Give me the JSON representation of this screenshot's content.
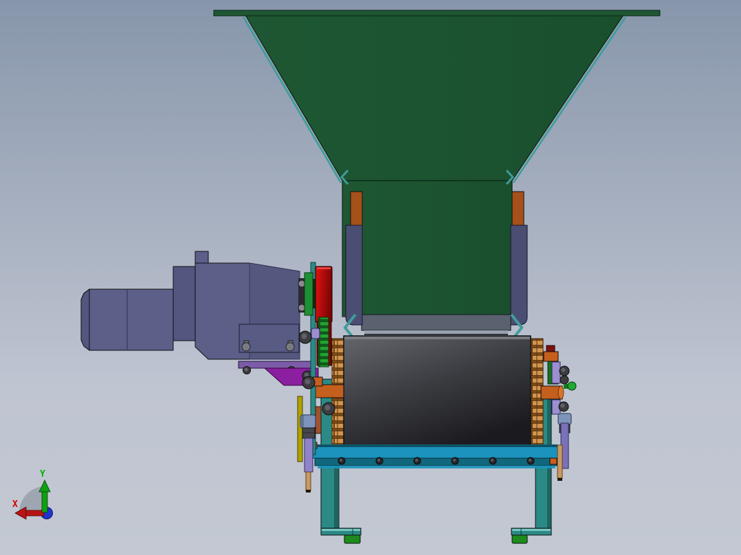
{
  "viewport": {
    "kind": "shaded 3d model side view",
    "triad": {
      "x_label": "X",
      "y_label": "Y",
      "x_color": "#d40000",
      "y_color": "#00b400",
      "z_color": "#2234cf",
      "fan_color": "#98a0ac"
    }
  },
  "palette": {
    "bg_top": "#8796ab",
    "bg_bottom": "#c3c8d2",
    "hopper_green": "#1e5733",
    "hopper_green_dark": "#1a4f2e",
    "edge_teal": "#3f9d9b",
    "chute_band_gray": "#59626e",
    "chute_band_light": "#97a0ac",
    "guard_slate": "#4b4e73",
    "bracket_rust": "#a6501a",
    "drum_light": "#64666d",
    "drum_dark": "#1b1b1f",
    "sprocket_orange": "#d2954e",
    "sprocket_shadow": "#7e4a16",
    "shaft_orange": "#c55f1d",
    "frame_teal": "#2b8a85",
    "rail_blue": "#1b93bd",
    "rail_dark": "#11677c",
    "foot_green": "#1d8a1d",
    "motor_slate": "#5c5f88",
    "motor_slate_dark": "#53567e",
    "plate_violet": "#7c5ca8",
    "bracket_magenta": "#8c1fa0",
    "pulley_red": "#c60d0d",
    "pulley_red_dark": "#7d0505",
    "chain_green": "#24a334",
    "chain_green_dark": "#115a1c",
    "disc_green": "#1f8f35",
    "lavender": "#9b8fd0",
    "steel_blue": "#7f94ba",
    "bar_yellow": "#b0a000",
    "rod_tan": "#c89a62",
    "bolt_dark": "#3c3c40",
    "sienna": "#a0522d"
  },
  "components": [
    {
      "name": "feed-hopper",
      "color": "#1e5733"
    },
    {
      "name": "discharge-chute",
      "color": "#1e5733"
    },
    {
      "name": "side-guard-panels",
      "color": "#4b4e73"
    },
    {
      "name": "crusher-drum",
      "color": "#2a2a2e"
    },
    {
      "name": "drum-sprockets",
      "color": "#d2954e"
    },
    {
      "name": "drive-shafts",
      "color": "#c55f1d"
    },
    {
      "name": "electric-motor",
      "color": "#5c5f88"
    },
    {
      "name": "gearbox",
      "color": "#5c5f88"
    },
    {
      "name": "drive-pulley",
      "color": "#c60d0d"
    },
    {
      "name": "drive-chain",
      "color": "#24a334"
    },
    {
      "name": "support-frame",
      "color": "#2b8a85"
    },
    {
      "name": "base-rail",
      "color": "#1b93bd"
    },
    {
      "name": "foot-pads",
      "color": "#1d8a1d"
    },
    {
      "name": "mounting-bracket",
      "color": "#8c1fa0"
    },
    {
      "name": "tension-rods",
      "color": "#c89a62"
    }
  ]
}
